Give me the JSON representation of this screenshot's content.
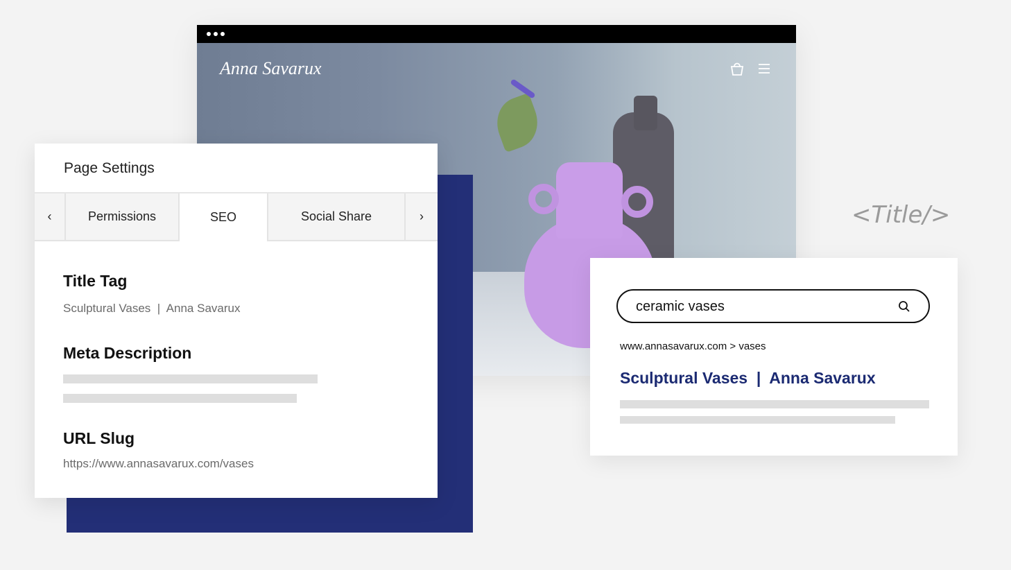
{
  "browser": {
    "brand": "Anna Savarux",
    "icons": [
      "shopping-bag-icon",
      "hamburger-menu-icon",
      "more-dots-icon"
    ]
  },
  "settings": {
    "title": "Page Settings",
    "tabs": {
      "prev": "‹",
      "permissions": "Permissions",
      "seo": "SEO",
      "social": "Social Share",
      "next": "›"
    },
    "title_tag": {
      "label": "Title Tag",
      "value": "Sculptural Vases  |  Anna Savarux"
    },
    "meta": {
      "label": "Meta Description"
    },
    "slug": {
      "label": "URL Slug",
      "value": "https://www.annasavarux.com/vases"
    }
  },
  "search": {
    "query": "ceramic vases",
    "breadcrumb": "www.annasavarux.com > vases",
    "result_title": "Sculptural Vases  |  Anna Savarux"
  },
  "tag_label": "<Title/>",
  "colors": {
    "navy": "#232f77",
    "result_link": "#1b2a72"
  }
}
